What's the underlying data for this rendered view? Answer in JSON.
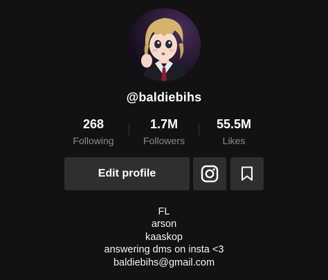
{
  "profile": {
    "username": "@baldiebihs",
    "avatar_icon": "anime-avatar-icon"
  },
  "stats": [
    {
      "value": "268",
      "label": "Following"
    },
    {
      "value": "1.7M",
      "label": "Followers"
    },
    {
      "value": "55.5M",
      "label": "Likes"
    }
  ],
  "actions": {
    "edit_profile_label": "Edit profile",
    "instagram_icon": "instagram-icon",
    "bookmark_icon": "bookmark-icon"
  },
  "bio": [
    "FL",
    "arson",
    "kaaskop",
    "answering dms on insta <3",
    "baldiebihs@gmail.com"
  ],
  "colors": {
    "background": "#121212",
    "button": "#2f2f2f",
    "muted_text": "#8a8a8a",
    "text": "#ffffff"
  }
}
